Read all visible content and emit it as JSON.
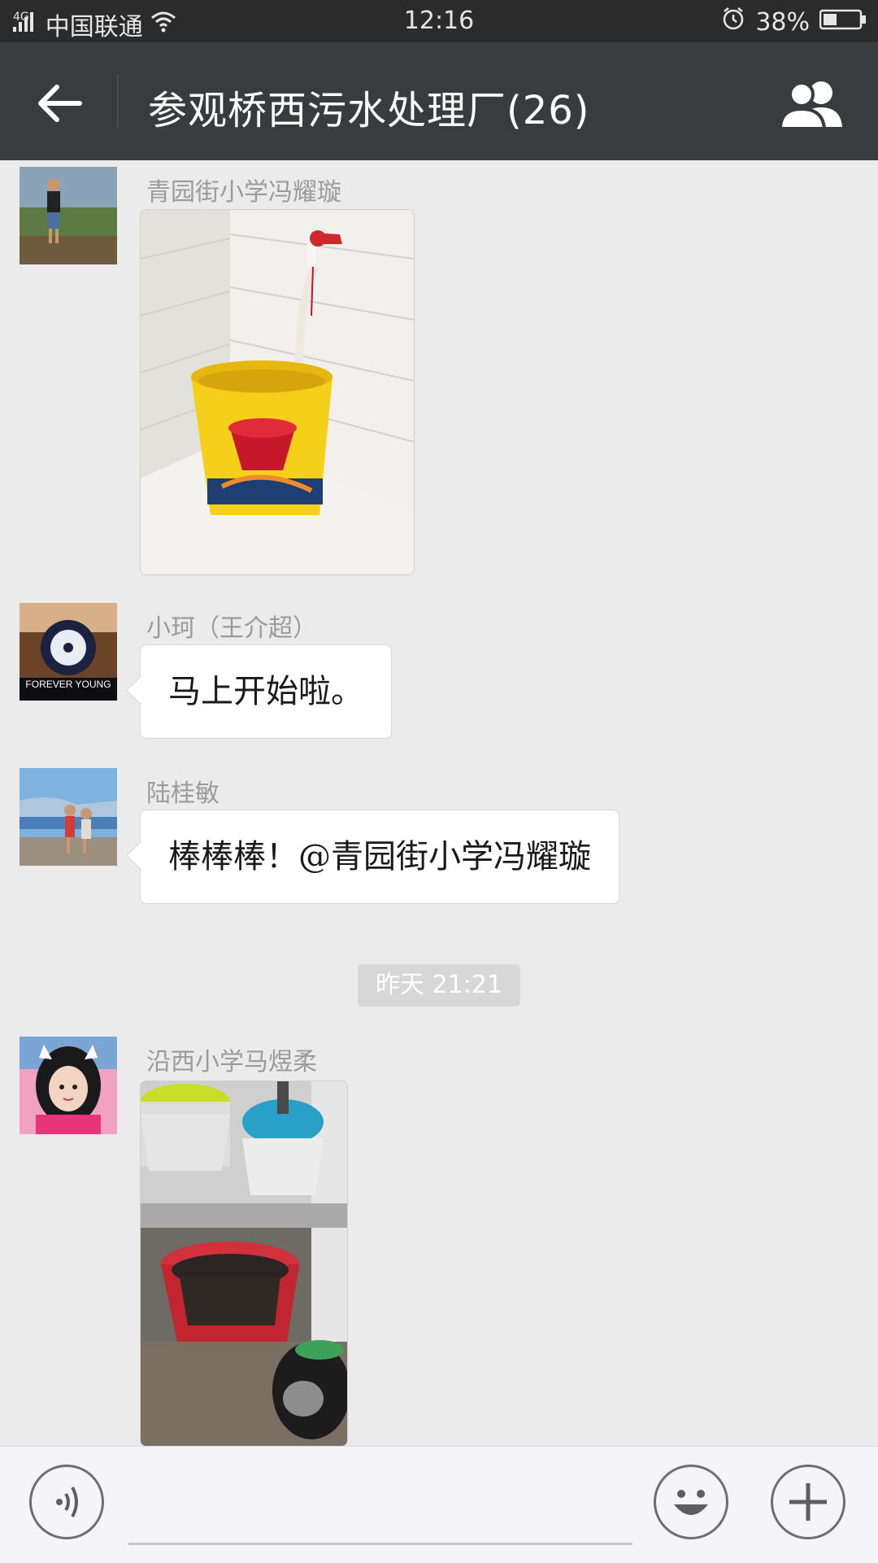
{
  "status_bar": {
    "network": "4G",
    "carrier": "中国联通",
    "time": "12:16",
    "battery": "38%",
    "battery_level": 0.38
  },
  "header": {
    "title": "参观桥西污水处理厂(26)",
    "back_icon": "arrow-left-icon",
    "members_icon": "group-members-icon"
  },
  "messages": [
    {
      "sender": "青园街小学冯耀璇",
      "type": "image"
    },
    {
      "sender": "小珂（王介超）",
      "type": "text",
      "text": "马上开始啦。",
      "avatar_text": "FOREVER YOUNG"
    },
    {
      "sender": "陆桂敏",
      "type": "text",
      "text": "棒棒棒！@青园街小学冯耀璇"
    },
    {
      "sender": "沿西小学马煜柔",
      "type": "image"
    }
  ],
  "time_divider": "昨天 21:21",
  "input_bar": {
    "voice_icon": "voice-icon",
    "emoji_icon": "emoji-icon",
    "add_icon": "plus-icon"
  },
  "colors": {
    "nav_bg": "#3a3b3e",
    "status_bg": "#2b2b2b",
    "chat_bg": "#ebebeb"
  }
}
